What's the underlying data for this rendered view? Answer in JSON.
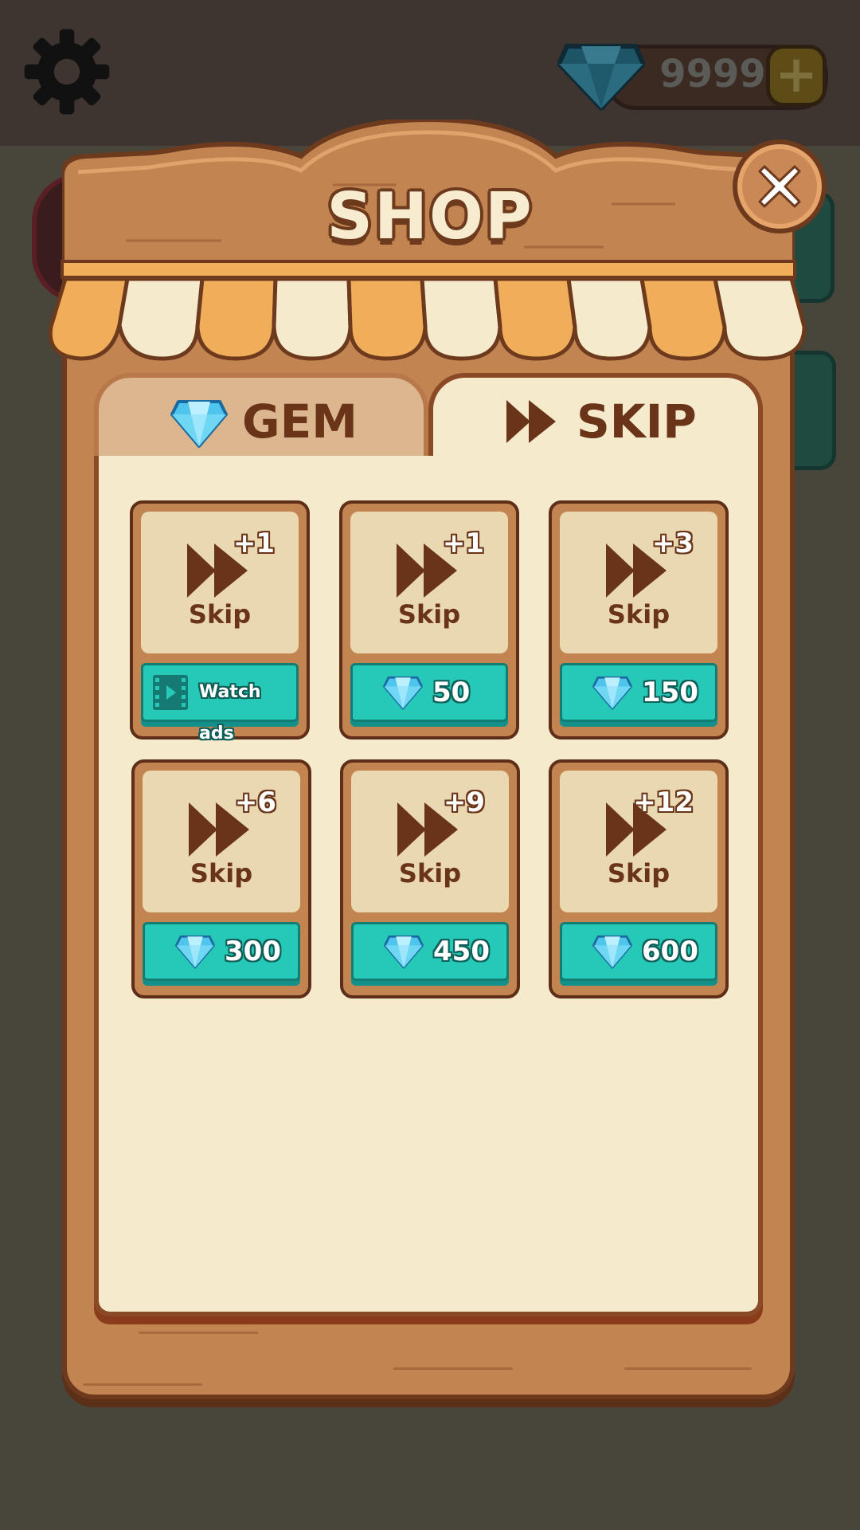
{
  "header": {
    "gem_count": "9999",
    "settings_icon": "gear-icon",
    "add_gems_icon": "plus-icon"
  },
  "shop": {
    "title": "SHOP",
    "close_icon": "close-icon",
    "tabs": [
      {
        "label": "GEM",
        "icon": "gem-icon",
        "active": false
      },
      {
        "label": "SKIP",
        "icon": "fast-forward-icon",
        "active": true
      }
    ],
    "items": [
      {
        "bonus": "+1",
        "label": "Skip",
        "price": "Watch ads",
        "price_icon": "film-icon"
      },
      {
        "bonus": "+1",
        "label": "Skip",
        "price": "50",
        "price_icon": "gem-icon"
      },
      {
        "bonus": "+3",
        "label": "Skip",
        "price": "150",
        "price_icon": "gem-icon"
      },
      {
        "bonus": "+6",
        "label": "Skip",
        "price": "300",
        "price_icon": "gem-icon"
      },
      {
        "bonus": "+9",
        "label": "Skip",
        "price": "450",
        "price_icon": "gem-icon"
      },
      {
        "bonus": "+12",
        "label": "Skip",
        "price": "600",
        "price_icon": "gem-icon"
      }
    ]
  },
  "colors": {
    "panel_wood": "#c28451",
    "panel_border": "#6e3a1e",
    "cream": "#f5eacc",
    "teal_button": "#26c9b8",
    "awning_orange": "#f0ae5a",
    "text_brown": "#6a3418"
  }
}
